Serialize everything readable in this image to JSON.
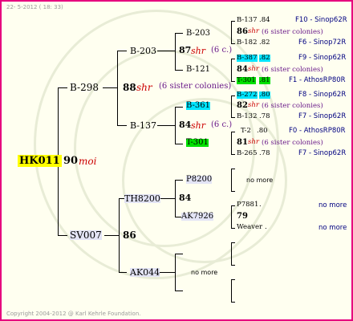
{
  "header": {
    "date_text": "22- 5-2012 ( 18: 33)"
  },
  "footer": {
    "copyright": "Copyright 2004-2012 @ Karl Kehrle Foundation."
  },
  "root": {
    "name": "HK011",
    "number": "90",
    "mark": "moi"
  },
  "g2_top": {
    "name": "B-298",
    "number": "88",
    "mark": "shr",
    "note": "(6 sister colonies)"
  },
  "g2_bottom": {
    "name": "SV007",
    "number": "86"
  },
  "g3": {
    "b203": {
      "name": "B-203",
      "number": "87",
      "mark": "shr",
      "note": "(6 c.)"
    },
    "b137": {
      "name": "B-137",
      "number": "84",
      "mark": "shr",
      "note": "(6 c.)"
    },
    "th8200": {
      "name": "TH8200",
      "number": "84"
    },
    "ak044": {
      "name": "AK044",
      "note": "no more"
    }
  },
  "g4": {
    "b203a": "B-203",
    "b121": "B-121",
    "b361": "B-361",
    "t301": "T-301",
    "p8200": "P8200",
    "ak7926": "AK7926",
    "ak7926_num": "79",
    "p8200_note": "no more"
  },
  "g5": [
    {
      "name": "B-137",
      "val": ".84",
      "right": "F10 - Sinop62R"
    },
    {
      "num": "86",
      "mark": "shr",
      "note": "(6 sister colonies)"
    },
    {
      "name": "B-182",
      "val": ".82",
      "right": "F6 - Sinop72R"
    },
    {
      "name": "B-387",
      "val": ".82",
      "right": "F9 - Sinop62R"
    },
    {
      "num": "84",
      "mark": "shr",
      "note": "(6 sister colonies)"
    },
    {
      "name": "T-301",
      "val": ".81",
      "right": "F1 - AthosRP80R"
    },
    {
      "name": "B-272",
      "val": ".80",
      "right": "F8 - Sinop62R"
    },
    {
      "num": "82",
      "mark": "shr",
      "note": "(6 sister colonies)"
    },
    {
      "name": "B-132",
      "val": ".78",
      "right": "F7 - Sinop62R"
    },
    {
      "name": "T-2",
      "val": ".80",
      "right": "F0 - AthosRP80R"
    },
    {
      "num": "81",
      "mark": "shr",
      "note": "(6 sister colonies)"
    },
    {
      "name": "B-265",
      "val": ".78",
      "right": "F7 - Sinop62R"
    },
    {
      "name": "P7881",
      "val": ".",
      "right": "no more"
    },
    {
      "name": "Weaver",
      "val": ".",
      "right": "no more"
    }
  ],
  "colors": {
    "border": "#e6007e",
    "highlight_root": "#ffff00",
    "cyan": "#00e5ff",
    "green": "#00e000",
    "red_mark": "#cc0000"
  }
}
